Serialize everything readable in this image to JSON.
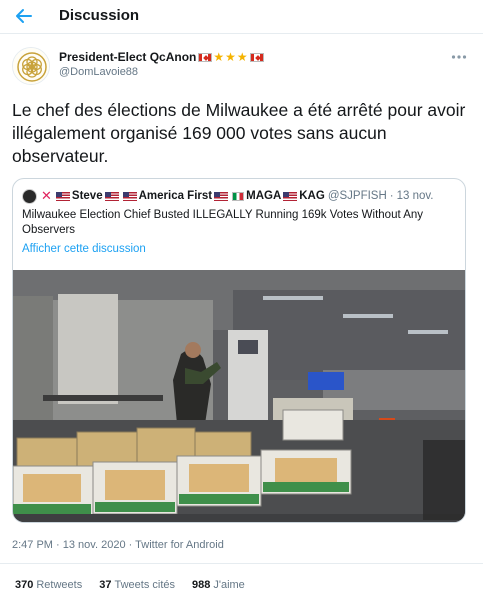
{
  "header": {
    "title": "Discussion",
    "back_icon": "arrow-left-icon",
    "accent_color": "#1da1f2"
  },
  "author": {
    "name": "President-Elect QcAnon",
    "handle": "@DomLavoie88",
    "badges": [
      "flag-canada",
      "star",
      "star",
      "star",
      "flag-canada"
    ]
  },
  "tweet": {
    "text": "Le chef des élections de Milwaukee a été arrêté pour avoir illégalement organisé 169 000 votes sans aucun observateur."
  },
  "quote": {
    "name_parts": [
      "Steve",
      "America First",
      "MAGA",
      "KAG"
    ],
    "handle": "@SJPFISH",
    "date": "13 nov.",
    "text": "Milwaukee Election Chief Busted ILLEGALLY Running 169k Votes Without Any Observers",
    "link": "Afficher cette discussion"
  },
  "meta": {
    "time": "2:47 PM",
    "date": "13 nov. 2020",
    "source": "Twitter for Android",
    "sep": "·"
  },
  "stats": {
    "retweets": "370",
    "retweets_label": "Retweets",
    "quotes": "37",
    "quotes_label": "Tweets cités",
    "likes": "988",
    "likes_label": "J'aime"
  }
}
